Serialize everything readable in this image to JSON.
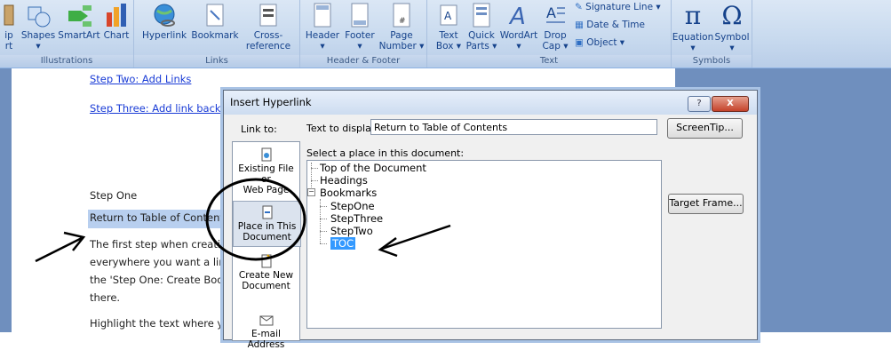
{
  "ribbon": {
    "groups": [
      {
        "label": "Illustrations"
      },
      {
        "label": "Links"
      },
      {
        "label": "Header & Footer"
      },
      {
        "label": "Text"
      },
      {
        "label": "Symbols"
      }
    ],
    "illustrations": {
      "clip_partial": "ip",
      "clip_partial2": "rt",
      "shapes": "Shapes",
      "smartart": "SmartArt",
      "chart": "Chart"
    },
    "links": {
      "hyperlink": "Hyperlink",
      "bookmark": "Bookmark",
      "cross_reference": "Cross-reference"
    },
    "header_footer": {
      "header": "Header",
      "footer": "Footer",
      "page_number_1": "Page",
      "page_number_2": "Number"
    },
    "text": {
      "textbox_1": "Text",
      "textbox_2": "Box",
      "quickparts_1": "Quick",
      "quickparts_2": "Parts",
      "wordart": "WordArt",
      "dropcap_1": "Drop",
      "dropcap_2": "Cap",
      "signature_line": "Signature Line",
      "date_time": "Date & Time",
      "object": "Object"
    },
    "symbols": {
      "equation": "Equation",
      "symbol": "Symbol"
    }
  },
  "document": {
    "step_two_link": "Step Two: Add Links",
    "step_three_link": "Step Three: Add link back to",
    "step_one_heading": "Step One",
    "return_toc": "Return to Table of Contents",
    "para1_line1": "The first step when creating",
    "para1_line2": "everywhere you want a link",
    "para1_line3": "the 'Step One: Create Bookr",
    "para1_line4": "there.",
    "para2_line1": "Highlight the text where yo"
  },
  "dialog": {
    "title": "Insert Hyperlink",
    "help_label": "?",
    "close_label": "X",
    "link_to_label": "Link to:",
    "text_to_display_label": "Text to display:",
    "text_to_display_value": "Return to Table of Contents",
    "screentip_label": "ScreenTip...",
    "select_place_label": "Select a place in this document:",
    "target_frame_label": "Target Frame...",
    "link_options": {
      "existing_1": "Existing File or",
      "existing_2": "Web Page",
      "place_1": "Place in This",
      "place_2": "Document",
      "create_1": "Create New",
      "create_2": "Document",
      "email": "E-mail Address"
    },
    "tree": {
      "top": "Top of the Document",
      "headings": "Headings",
      "bookmarks": "Bookmarks",
      "children": [
        "StepOne",
        "StepThree",
        "StepTwo",
        "TOC"
      ]
    }
  },
  "colors": {
    "link_blue": "#1a3cd6",
    "selection": "#3399ff",
    "ribbon_text": "#15428b"
  }
}
